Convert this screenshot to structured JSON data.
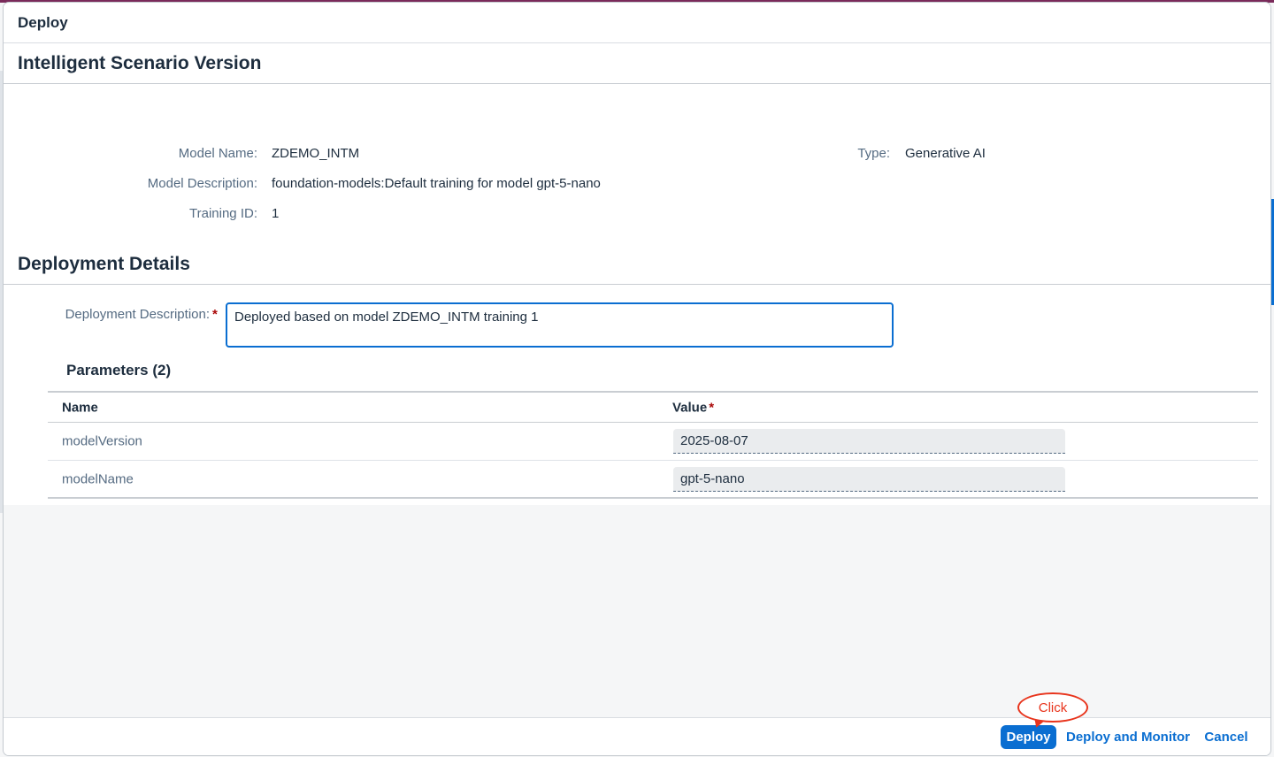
{
  "dialog": {
    "title": "Deploy"
  },
  "scenario": {
    "section_title": "Intelligent Scenario Version",
    "model_name_label": "Model Name:",
    "model_name": "ZDEMO_INTM",
    "type_label": "Type:",
    "type": "Generative AI",
    "model_description_label": "Model Description:",
    "model_description": "foundation-models:Default training for model gpt-5-nano",
    "training_id_label": "Training ID:",
    "training_id": "1"
  },
  "deployment": {
    "section_title": "Deployment Details",
    "description_label": "Deployment Description:",
    "required_marker": "*",
    "description_value": "Deployed based on model ZDEMO_INTM training 1"
  },
  "parameters": {
    "title": "Parameters (2)",
    "columns": {
      "name": "Name",
      "value": "Value"
    },
    "rows": [
      {
        "name": "modelVersion",
        "value": "2025-08-07"
      },
      {
        "name": "modelName",
        "value": "gpt-5-nano"
      }
    ]
  },
  "footer": {
    "deploy_label": "Deploy",
    "deploy_monitor_label": "Deploy and Monitor",
    "cancel_label": "Cancel"
  },
  "annotation": {
    "callout_text": "Click"
  },
  "colors": {
    "accent": "#0a6ed1",
    "required": "#aa0808",
    "callout": "#e8341c"
  }
}
